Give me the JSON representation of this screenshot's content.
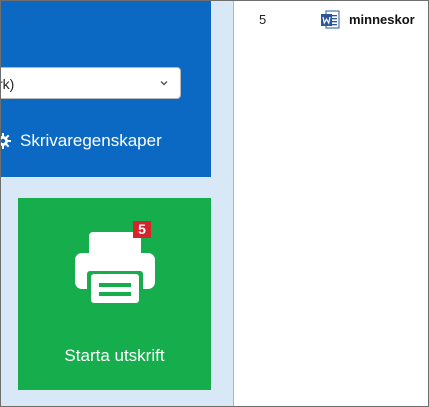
{
  "settings": {
    "printer_select_value": "rk)",
    "printer_properties_label": "Skrivaregenskaper"
  },
  "print_tile": {
    "label": "Starta utskrift",
    "badge_count": "5",
    "icon": "printer-icon"
  },
  "file_list": {
    "rows": [
      {
        "number": "5",
        "icon": "word-document-icon",
        "name": "minneskor"
      }
    ]
  },
  "colors": {
    "panel_blue": "#0c69c3",
    "tile_green": "#16ae4c",
    "badge_red": "#d3252b",
    "background": "#d9e8f6"
  }
}
